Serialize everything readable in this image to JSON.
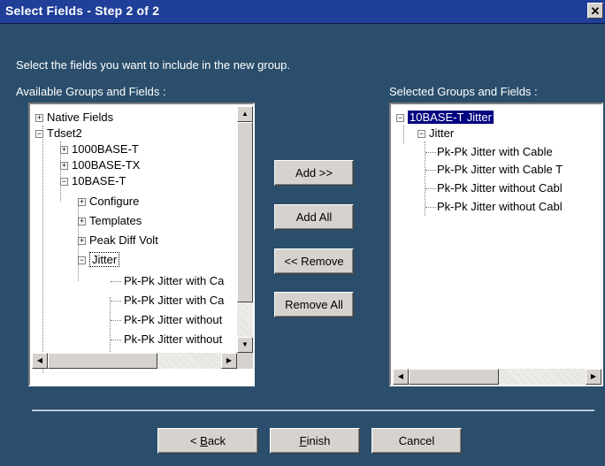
{
  "window": {
    "title": "Select Fields - Step 2 of 2",
    "close_glyph": "✕"
  },
  "instruction": "Select the fields you want to include in the new group.",
  "available": {
    "label": "Available Groups and Fields :",
    "items": [
      {
        "text": "Native Fields",
        "toggle": "+"
      },
      {
        "text": "Tdset2",
        "toggle": "−"
      },
      {
        "text": "1000BASE-T",
        "toggle": "+"
      },
      {
        "text": "100BASE-TX",
        "toggle": "+"
      },
      {
        "text": "10BASE-T",
        "toggle": "−"
      },
      {
        "text": "Configure",
        "toggle": "+"
      },
      {
        "text": "Templates",
        "toggle": "+"
      },
      {
        "text": "Peak Diff Volt",
        "toggle": "+"
      },
      {
        "text": "Jitter",
        "toggle": "−"
      },
      {
        "text": "Pk-Pk Jitter with Ca"
      },
      {
        "text": "Pk-Pk Jitter with Ca"
      },
      {
        "text": "Pk-Pk Jitter without"
      },
      {
        "text": "Pk-Pk Jitter without"
      }
    ]
  },
  "selected": {
    "label": "Selected Groups and Fields :",
    "items": [
      {
        "text": "10BASE-T Jitter",
        "toggle": "−"
      },
      {
        "text": "Jitter",
        "toggle": "−"
      },
      {
        "text": "Pk-Pk Jitter with Cable"
      },
      {
        "text": "Pk-Pk Jitter with Cable T"
      },
      {
        "text": "Pk-Pk Jitter without Cabl"
      },
      {
        "text": "Pk-Pk Jitter without Cabl"
      }
    ]
  },
  "buttons": {
    "add": "Add >>",
    "add_all": "Add All",
    "remove": "<< Remove",
    "remove_all": "Remove All",
    "back_prefix": "< ",
    "back_key": "B",
    "back_rest": "ack",
    "finish_key": "F",
    "finish_rest": "inish",
    "cancel": "Cancel"
  },
  "scroll_glyphs": {
    "up": "▲",
    "down": "▼",
    "left": "◀",
    "right": "▶"
  }
}
